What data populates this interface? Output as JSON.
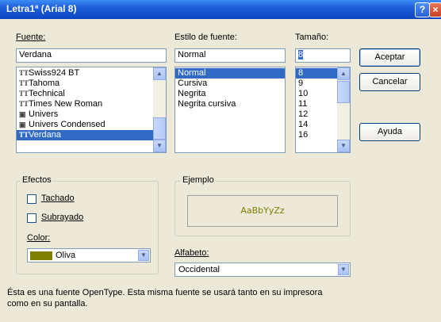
{
  "title": "Letra1ª (Arial 8)",
  "titlebar_buttons": {
    "help": "?",
    "close": "×"
  },
  "font": {
    "label": "Fuente:",
    "value": "Verdana",
    "items": [
      {
        "icon": "TT",
        "name": "Swiss924 BT"
      },
      {
        "icon": "TT",
        "name": "Tahoma"
      },
      {
        "icon": "TT",
        "name": "Technical"
      },
      {
        "icon": "TT",
        "name": "Times New Roman"
      },
      {
        "icon": "▣",
        "name": "Univers"
      },
      {
        "icon": "▣",
        "name": "Univers Condensed"
      },
      {
        "icon": "TT",
        "name": "Verdana"
      }
    ]
  },
  "style": {
    "label": "Estilo de fuente:",
    "value": "Normal",
    "items": [
      "Normal",
      "Cursiva",
      "Negrita",
      "Negrita cursiva"
    ]
  },
  "size": {
    "label": "Tamaño:",
    "value": "8",
    "items": [
      "8",
      "9",
      "10",
      "11",
      "12",
      "14",
      "16"
    ]
  },
  "buttons": {
    "ok": "Aceptar",
    "cancel": "Cancelar",
    "help": "Ayuda"
  },
  "effects": {
    "title": "Efectos",
    "strikeout": "Tachado",
    "underline": "Subrayado",
    "color_label": "Color:",
    "color_value": "Oliva",
    "color_hex": "#808000"
  },
  "sample": {
    "title": "Ejemplo",
    "text": "AaBbYyZz"
  },
  "script": {
    "label": "Alfabeto:",
    "value": "Occidental"
  },
  "note": "Ésta es una fuente OpenType. Esta misma fuente se usará tanto en su impresora como en su pantalla."
}
